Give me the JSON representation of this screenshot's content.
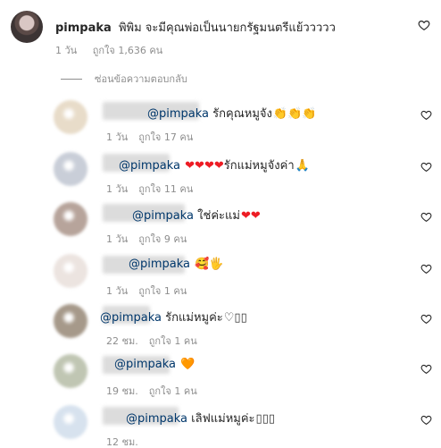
{
  "top_comment": {
    "username": "pimpaka",
    "text": "พิพิม จะมีคุณพ่อเป็นนายกรัฐมนตรีแย้ววววว",
    "time": "1 วัน",
    "likes": "ถูกใจ 1,636 คน"
  },
  "hide_replies_label": "ซ่อนข้อความตอบกลับ",
  "replies": [
    {
      "mention": "@pimpaka",
      "text": "รักคุณหมูจัง",
      "emoji": "👏👏👏",
      "time": "1 วัน",
      "likes": "ถูกใจ 17 คน"
    },
    {
      "mention": "@pimpaka",
      "text": "",
      "emoji": "❤❤❤❤",
      "text2": "รักแม่หมูจังค่า",
      "emoji2": "🙏",
      "time": "1 วัน",
      "likes": "ถูกใจ 11 คน"
    },
    {
      "mention": "@pimpaka",
      "text": "ใช่ค่ะแม่",
      "emoji": "❤❤",
      "time": "1 วัน",
      "likes": "ถูกใจ 9 คน"
    },
    {
      "mention": "@pimpaka",
      "text": "",
      "emoji": "🥰🖐",
      "time": "1 วัน",
      "likes": "ถูกใจ 1 คน"
    },
    {
      "mention": "@pimpaka",
      "text": "รักแม่หมูค่ะ",
      "emoji": "♡▯▯",
      "time": "22 ชม.",
      "likes": "ถูกใจ 1 คน"
    },
    {
      "mention": "@pimpaka",
      "text": "",
      "emoji": "🧡",
      "time": "19 ชม.",
      "likes": "ถูกใจ 1 คน"
    },
    {
      "mention": "@pimpaka",
      "text": "เลิฟแม่หมูค่ะ",
      "emoji": "▯▯▯",
      "time": "12 ชม.",
      "likes": ""
    }
  ],
  "colors": {
    "mention": "#00376b",
    "meta": "#8e8e8e",
    "text": "#262626"
  },
  "icons": {
    "like": "heart-outline-icon"
  }
}
